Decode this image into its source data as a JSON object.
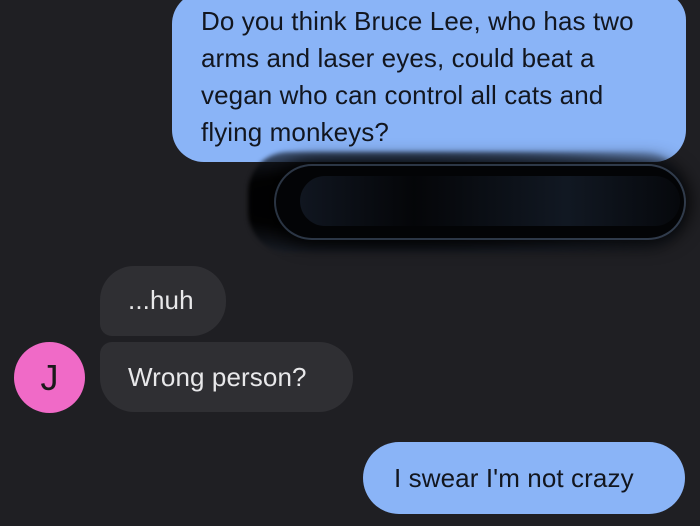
{
  "conversation": {
    "messages": [
      {
        "direction": "outgoing",
        "text": "Do you think Bruce Lee, who has two arms and laser eyes, could beat a vegan who can control all cats and flying monkeys?"
      },
      {
        "direction": "incoming",
        "text": "...huh"
      },
      {
        "direction": "incoming",
        "text": "Wrong person?"
      },
      {
        "direction": "outgoing",
        "text": "I swear I'm not crazy"
      }
    ],
    "contact": {
      "avatar_initial": "J",
      "avatar_color": "#f06ac7"
    }
  },
  "colors": {
    "background": "#1f1f23",
    "outgoing_bubble": "#8ab4f7",
    "incoming_bubble": "#2f2f33",
    "incoming_text": "#e8e8ea",
    "outgoing_text": "#12161f"
  }
}
